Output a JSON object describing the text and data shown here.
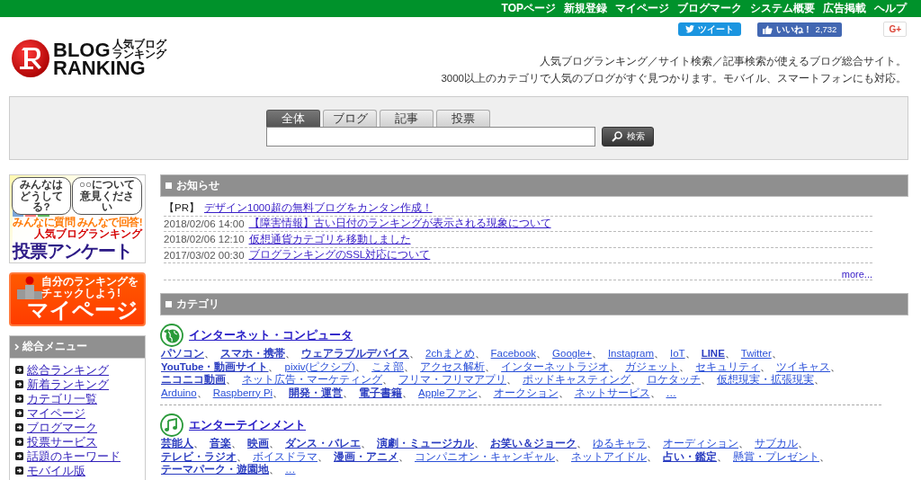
{
  "top_nav": [
    "TOPページ",
    "新規登録",
    "マイページ",
    "ブログマーク",
    "システム概要",
    "広告掲載",
    "ヘルプ"
  ],
  "logo": {
    "title_1": "BLOG",
    "title_2": "RANKING",
    "subtitle_1": "人気ブログ",
    "subtitle_2": "ランキング"
  },
  "social": {
    "tweet": "ツイート",
    "like": "いいね！",
    "like_count": "2,732",
    "gplus": "G+"
  },
  "tagline": [
    "人気ブログランキング／サイト検索／記事検索が使えるブログ総合サイト。",
    "3000以上のカテゴリで人気のブログがすぐ見つかります。モバイル、スマートフォンにも対応。"
  ],
  "search": {
    "tabs": [
      {
        "label": "全体",
        "selected": true
      },
      {
        "label": "ブログ",
        "selected": false
      },
      {
        "label": "記事",
        "selected": false
      },
      {
        "label": "投票",
        "selected": false
      }
    ],
    "button": "検索"
  },
  "sidebar": {
    "vote_banner": {
      "bubble_1": "みんなはどうしてる?",
      "bubble_2": "○○について意見ください",
      "slogan": "みんなに質問 みんなで回答!",
      "brand": "人気ブログランキング",
      "title": "投票アンケート"
    },
    "mypage_banner": {
      "caption_1": "自分のランキングを",
      "caption_2": "チェックしよう!",
      "title": "マイページ"
    },
    "menu": {
      "title": "総合メニュー",
      "items": [
        "総合ランキング",
        "新着ランキング",
        "カテゴリ一覧",
        "マイページ",
        "ブログマーク",
        "投票サービス",
        "話題のキーワード",
        "モバイル版"
      ]
    }
  },
  "news": {
    "title": "お知らせ",
    "items": [
      {
        "kind": "pr",
        "label": "【PR】",
        "link": "デザイン1000超の無料ブログをカンタン作成！"
      },
      {
        "kind": "dated",
        "label": "2018/02/06 14:00",
        "link": "【障害情報】古い日付のランキングが表示される現象について"
      },
      {
        "kind": "dated",
        "label": "2018/02/06 12:10",
        "link": "仮想通貨カテゴリを移動しました"
      },
      {
        "kind": "dated",
        "label": "2017/03/02 00:30",
        "link": "ブログランキングのSSL対応について"
      }
    ],
    "more": "more..."
  },
  "categories": {
    "title": "カテゴリ",
    "items": [
      {
        "name": "インターネット・コンピュータ",
        "kind": "globe",
        "links": [
          {
            "label": "パソコン",
            "bold": true,
            "sep": "、"
          },
          {
            "label": "スマホ・携帯",
            "bold": true,
            "sep": "、"
          },
          {
            "label": "ウェアラブルデバイス",
            "bold": true,
            "sep": "、"
          },
          {
            "label": "2chまとめ",
            "bold": false,
            "sep": "、"
          },
          {
            "label": "Facebook",
            "bold": false,
            "sep": "、"
          },
          {
            "label": "Google+",
            "bold": false,
            "sep": "、"
          },
          {
            "label": "Instagram",
            "bold": false,
            "sep": "、"
          },
          {
            "label": "IoT",
            "bold": false,
            "sep": "、"
          },
          {
            "label": "LINE",
            "bold": true,
            "sep": "、"
          },
          {
            "label": "Twitter",
            "bold": false,
            "sep": "、"
          },
          {
            "label": "YouTube・動画サイト",
            "bold": true,
            "sep": "、"
          },
          {
            "label": "pixiv(ピクシブ)",
            "bold": false,
            "sep": "、"
          },
          {
            "label": "こえ部",
            "bold": false,
            "sep": "、"
          },
          {
            "label": "アクセス解析",
            "bold": false,
            "sep": "、"
          },
          {
            "label": "インターネットラジオ",
            "bold": false,
            "sep": "、"
          },
          {
            "label": "ガジェット",
            "bold": false,
            "sep": "、"
          },
          {
            "label": "セキュリティ",
            "bold": false,
            "sep": "、"
          },
          {
            "label": "ツイキャス",
            "bold": false,
            "sep": "、"
          },
          {
            "label": "ニコニコ動画",
            "bold": true,
            "sep": "、"
          },
          {
            "label": "ネット広告・マーケティング",
            "bold": false,
            "sep": "、"
          },
          {
            "label": "フリマ・フリマアプリ",
            "bold": false,
            "sep": "、"
          },
          {
            "label": "ポッドキャスティング",
            "bold": false,
            "sep": "、"
          },
          {
            "label": "ロケタッチ",
            "bold": false,
            "sep": "、"
          },
          {
            "label": "仮想現実・拡張現実",
            "bold": false,
            "sep": "、"
          },
          {
            "label": "Arduino",
            "bold": false,
            "sep": "、"
          },
          {
            "label": "Raspberry Pi",
            "bold": false,
            "sep": "、"
          },
          {
            "label": "開発・運営",
            "bold": true,
            "sep": "、"
          },
          {
            "label": "電子書籍",
            "bold": true,
            "sep": "、"
          },
          {
            "label": "Appleファン",
            "bold": false,
            "sep": "、"
          },
          {
            "label": "オークション",
            "bold": false,
            "sep": "、"
          },
          {
            "label": "ネットサービス",
            "bold": false,
            "sep": "、"
          },
          {
            "label": "…",
            "bold": false
          }
        ]
      },
      {
        "name": "エンターテインメント",
        "kind": "music",
        "links": [
          {
            "label": "芸能人",
            "bold": true,
            "sep": "、"
          },
          {
            "label": "音楽",
            "bold": true,
            "sep": "、"
          },
          {
            "label": "映画",
            "bold": true,
            "sep": "、"
          },
          {
            "label": "ダンス・バレエ",
            "bold": true,
            "sep": "、"
          },
          {
            "label": "演劇・ミュージカル",
            "bold": true,
            "sep": "、"
          },
          {
            "label": "お笑い＆ジョーク",
            "bold": true,
            "sep": "、"
          },
          {
            "label": "ゆるキャラ",
            "bold": false,
            "sep": "、"
          },
          {
            "label": "オーディション",
            "bold": false,
            "sep": "、"
          },
          {
            "label": "サブカル",
            "bold": false,
            "sep": "、"
          },
          {
            "label": "テレビ・ラジオ",
            "bold": true,
            "sep": "、"
          },
          {
            "label": "ボイスドラマ",
            "bold": false,
            "sep": "、"
          },
          {
            "label": "漫画・アニメ",
            "bold": true,
            "sep": "、"
          },
          {
            "label": "コンパニオン・キャンギャル",
            "bold": false,
            "sep": "、"
          },
          {
            "label": "ネットアイドル",
            "bold": false,
            "sep": "、"
          },
          {
            "label": "占い・鑑定",
            "bold": true,
            "sep": "、"
          },
          {
            "label": "懸賞・プレゼント",
            "bold": false,
            "sep": "、"
          },
          {
            "label": "テーマパーク・遊園地",
            "bold": true,
            "sep": "、"
          },
          {
            "label": "…",
            "bold": false
          }
        ]
      }
    ]
  }
}
